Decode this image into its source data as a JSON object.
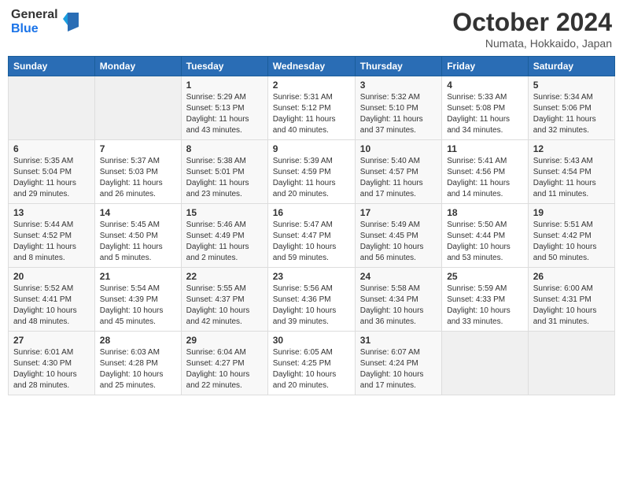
{
  "header": {
    "logo_general": "General",
    "logo_blue": "Blue",
    "month_title": "October 2024",
    "location": "Numata, Hokkaido, Japan"
  },
  "weekdays": [
    "Sunday",
    "Monday",
    "Tuesday",
    "Wednesday",
    "Thursday",
    "Friday",
    "Saturday"
  ],
  "weeks": [
    [
      {
        "day": "",
        "info": ""
      },
      {
        "day": "",
        "info": ""
      },
      {
        "day": "1",
        "info": "Sunrise: 5:29 AM\nSunset: 5:13 PM\nDaylight: 11 hours and 43 minutes."
      },
      {
        "day": "2",
        "info": "Sunrise: 5:31 AM\nSunset: 5:12 PM\nDaylight: 11 hours and 40 minutes."
      },
      {
        "day": "3",
        "info": "Sunrise: 5:32 AM\nSunset: 5:10 PM\nDaylight: 11 hours and 37 minutes."
      },
      {
        "day": "4",
        "info": "Sunrise: 5:33 AM\nSunset: 5:08 PM\nDaylight: 11 hours and 34 minutes."
      },
      {
        "day": "5",
        "info": "Sunrise: 5:34 AM\nSunset: 5:06 PM\nDaylight: 11 hours and 32 minutes."
      }
    ],
    [
      {
        "day": "6",
        "info": "Sunrise: 5:35 AM\nSunset: 5:04 PM\nDaylight: 11 hours and 29 minutes."
      },
      {
        "day": "7",
        "info": "Sunrise: 5:37 AM\nSunset: 5:03 PM\nDaylight: 11 hours and 26 minutes."
      },
      {
        "day": "8",
        "info": "Sunrise: 5:38 AM\nSunset: 5:01 PM\nDaylight: 11 hours and 23 minutes."
      },
      {
        "day": "9",
        "info": "Sunrise: 5:39 AM\nSunset: 4:59 PM\nDaylight: 11 hours and 20 minutes."
      },
      {
        "day": "10",
        "info": "Sunrise: 5:40 AM\nSunset: 4:57 PM\nDaylight: 11 hours and 17 minutes."
      },
      {
        "day": "11",
        "info": "Sunrise: 5:41 AM\nSunset: 4:56 PM\nDaylight: 11 hours and 14 minutes."
      },
      {
        "day": "12",
        "info": "Sunrise: 5:43 AM\nSunset: 4:54 PM\nDaylight: 11 hours and 11 minutes."
      }
    ],
    [
      {
        "day": "13",
        "info": "Sunrise: 5:44 AM\nSunset: 4:52 PM\nDaylight: 11 hours and 8 minutes."
      },
      {
        "day": "14",
        "info": "Sunrise: 5:45 AM\nSunset: 4:50 PM\nDaylight: 11 hours and 5 minutes."
      },
      {
        "day": "15",
        "info": "Sunrise: 5:46 AM\nSunset: 4:49 PM\nDaylight: 11 hours and 2 minutes."
      },
      {
        "day": "16",
        "info": "Sunrise: 5:47 AM\nSunset: 4:47 PM\nDaylight: 10 hours and 59 minutes."
      },
      {
        "day": "17",
        "info": "Sunrise: 5:49 AM\nSunset: 4:45 PM\nDaylight: 10 hours and 56 minutes."
      },
      {
        "day": "18",
        "info": "Sunrise: 5:50 AM\nSunset: 4:44 PM\nDaylight: 10 hours and 53 minutes."
      },
      {
        "day": "19",
        "info": "Sunrise: 5:51 AM\nSunset: 4:42 PM\nDaylight: 10 hours and 50 minutes."
      }
    ],
    [
      {
        "day": "20",
        "info": "Sunrise: 5:52 AM\nSunset: 4:41 PM\nDaylight: 10 hours and 48 minutes."
      },
      {
        "day": "21",
        "info": "Sunrise: 5:54 AM\nSunset: 4:39 PM\nDaylight: 10 hours and 45 minutes."
      },
      {
        "day": "22",
        "info": "Sunrise: 5:55 AM\nSunset: 4:37 PM\nDaylight: 10 hours and 42 minutes."
      },
      {
        "day": "23",
        "info": "Sunrise: 5:56 AM\nSunset: 4:36 PM\nDaylight: 10 hours and 39 minutes."
      },
      {
        "day": "24",
        "info": "Sunrise: 5:58 AM\nSunset: 4:34 PM\nDaylight: 10 hours and 36 minutes."
      },
      {
        "day": "25",
        "info": "Sunrise: 5:59 AM\nSunset: 4:33 PM\nDaylight: 10 hours and 33 minutes."
      },
      {
        "day": "26",
        "info": "Sunrise: 6:00 AM\nSunset: 4:31 PM\nDaylight: 10 hours and 31 minutes."
      }
    ],
    [
      {
        "day": "27",
        "info": "Sunrise: 6:01 AM\nSunset: 4:30 PM\nDaylight: 10 hours and 28 minutes."
      },
      {
        "day": "28",
        "info": "Sunrise: 6:03 AM\nSunset: 4:28 PM\nDaylight: 10 hours and 25 minutes."
      },
      {
        "day": "29",
        "info": "Sunrise: 6:04 AM\nSunset: 4:27 PM\nDaylight: 10 hours and 22 minutes."
      },
      {
        "day": "30",
        "info": "Sunrise: 6:05 AM\nSunset: 4:25 PM\nDaylight: 10 hours and 20 minutes."
      },
      {
        "day": "31",
        "info": "Sunrise: 6:07 AM\nSunset: 4:24 PM\nDaylight: 10 hours and 17 minutes."
      },
      {
        "day": "",
        "info": ""
      },
      {
        "day": "",
        "info": ""
      }
    ]
  ]
}
